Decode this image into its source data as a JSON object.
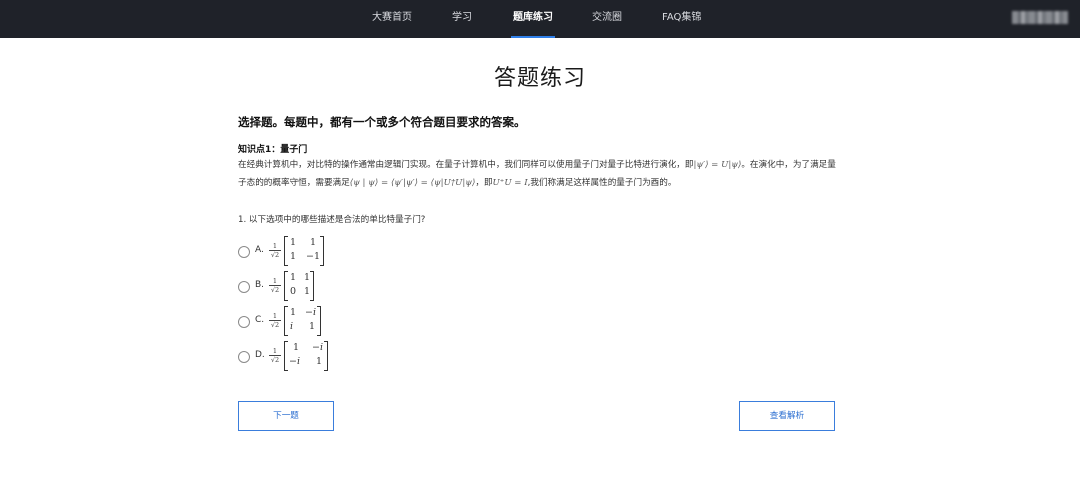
{
  "nav": {
    "items": [
      {
        "label": "大赛首页",
        "active": false
      },
      {
        "label": "学习",
        "active": false
      },
      {
        "label": "题库练习",
        "active": true
      },
      {
        "label": "交流圈",
        "active": false
      },
      {
        "label": "FAQ集锦",
        "active": false
      }
    ]
  },
  "page": {
    "title": "答题练习",
    "intro": "选择题。每题中，都有一个或多个符合题目要求的答案。",
    "knowledge_point": {
      "title": "知识点1：量子门",
      "text_1": "在经典计算机中，对比特的操作通常由逻辑门实现。在量子计算机中，我们同样可以使用量子门对量子比特进行演化，即",
      "math_1": "|ψ′⟩ = U|ψ⟩",
      "text_2": "。在演化中，为了满足量子态的的概率守恒，需要满足",
      "math_2": "⟨ψ | ψ⟩ = ⟨ψ′|ψ′⟩ = ⟨ψ|U†U|ψ⟩",
      "text_3": "，即",
      "math_3": "U⁺U = I",
      "text_4": ",我们称满足这样属性的量子门为酉的。"
    },
    "question": "1. 以下选项中的哪些描述是合法的单比特量子门?"
  },
  "options": [
    {
      "label": "A.",
      "factor_num": "1",
      "factor_den": "√2",
      "matrix": [
        [
          "1",
          "1"
        ],
        [
          "1",
          "−1"
        ]
      ]
    },
    {
      "label": "B.",
      "factor_num": "1",
      "factor_den": "√2",
      "matrix": [
        [
          "1",
          "1"
        ],
        [
          "0",
          "1"
        ]
      ]
    },
    {
      "label": "C.",
      "factor_num": "1",
      "factor_den": "√2",
      "matrix": [
        [
          "1",
          "−i"
        ],
        [
          "i",
          "1"
        ]
      ]
    },
    {
      "label": "D.",
      "factor_num": "1",
      "factor_den": "√2",
      "matrix": [
        [
          "1",
          "−i"
        ],
        [
          "−i",
          "1"
        ]
      ]
    }
  ],
  "buttons": {
    "next": "下一题",
    "analysis": "查看解析"
  },
  "colors": {
    "topbar": "#1f2229",
    "accent": "#2f7fe8",
    "button_border": "#3a7ddc"
  }
}
